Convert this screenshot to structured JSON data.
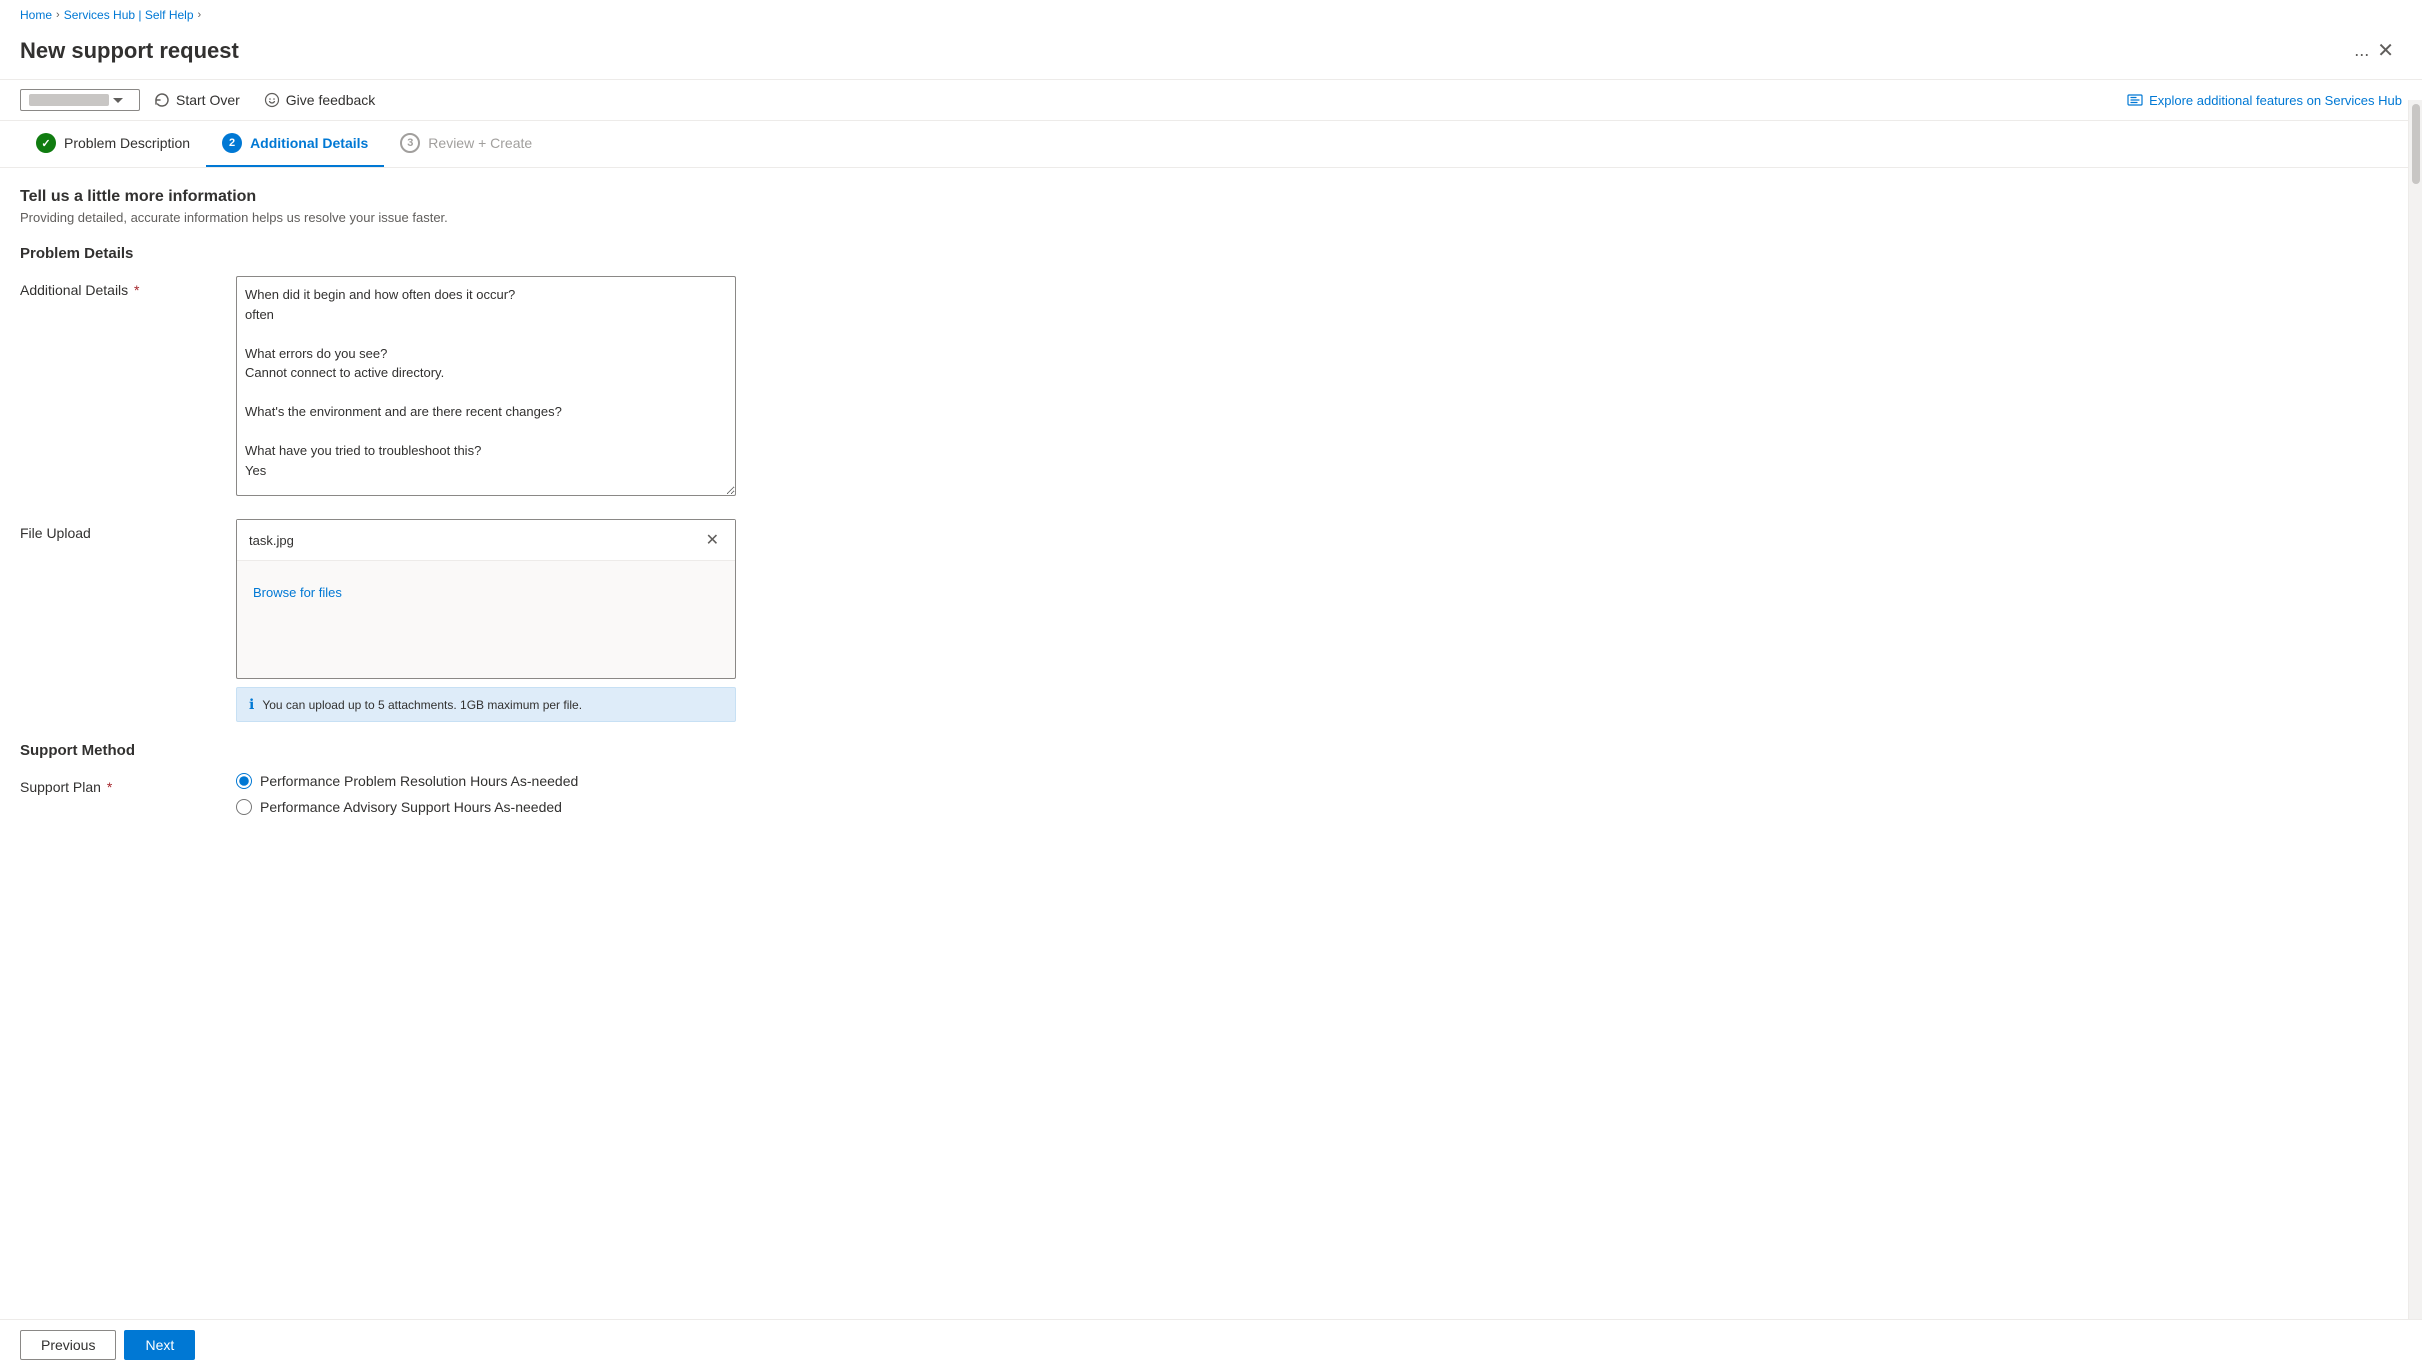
{
  "breadcrumb": {
    "home": "Home",
    "services_hub": "Services Hub | Self Help"
  },
  "page": {
    "title": "New support request",
    "dots_label": "...",
    "close_label": "✕"
  },
  "toolbar": {
    "start_over_label": "Start Over",
    "give_feedback_label": "Give feedback",
    "explore_label": "Explore additional features on Services Hub"
  },
  "steps": [
    {
      "id": "problem-description",
      "number": "✓",
      "label": "Problem Description",
      "state": "completed"
    },
    {
      "id": "additional-details",
      "number": "2",
      "label": "Additional Details",
      "state": "active"
    },
    {
      "id": "review-create",
      "number": "3",
      "label": "Review + Create",
      "state": "pending"
    }
  ],
  "form": {
    "heading": "Tell us a little more information",
    "subtext": "Providing detailed, accurate information helps us resolve your issue faster.",
    "problem_details_heading": "Problem Details",
    "additional_details_label": "Additional Details",
    "additional_details_value": "When did it begin and how often does it occur?\noften\n\nWhat errors do you see?\nCannot connect to active directory.\n\nWhat's the environment and are there recent changes?\n\nWhat have you tried to troubleshoot this?\nYes",
    "file_upload_label": "File Upload",
    "file_name": "task.jpg",
    "browse_label": "Browse for files",
    "upload_info": "You can upload up to 5 attachments. 1GB maximum per file.",
    "support_method_heading": "Support Method",
    "support_plan_label": "Support Plan",
    "support_options": [
      {
        "id": "opt1",
        "label": "Performance Problem Resolution Hours As-needed",
        "selected": true
      },
      {
        "id": "opt2",
        "label": "Performance Advisory Support Hours As-needed",
        "selected": false
      }
    ]
  },
  "buttons": {
    "previous": "Previous",
    "next": "Next"
  }
}
